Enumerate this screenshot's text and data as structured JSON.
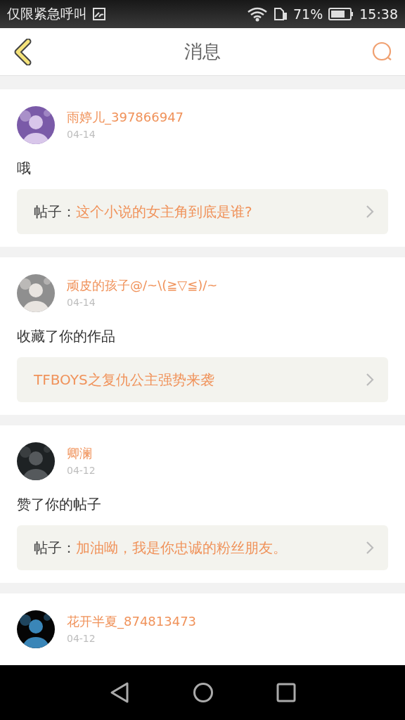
{
  "status_bar": {
    "carrier": "仅限紧急呼叫",
    "battery": "71%",
    "time": "15:38"
  },
  "header": {
    "title": "消息"
  },
  "messages": [
    {
      "user": "雨婷儿_397866947",
      "date": "04-14",
      "action": "哦",
      "link": {
        "prefix": "帖子：",
        "title": "这个小说的女主角到底是谁?"
      }
    },
    {
      "user": "顽皮的孩子@/~\\(≧▽≦)/~",
      "date": "04-14",
      "action": "收藏了你的作品",
      "link": {
        "title": "TFBOYS之复仇公主强势来袭"
      }
    },
    {
      "user": "卿澜",
      "date": "04-12",
      "action": "赞了你的帖子",
      "link": {
        "prefix": "帖子：",
        "title": "加油呦，我是你忠诚的粉丝朋友。"
      }
    },
    {
      "user": "花开半夏_874813473",
      "date": "04-12"
    }
  ]
}
